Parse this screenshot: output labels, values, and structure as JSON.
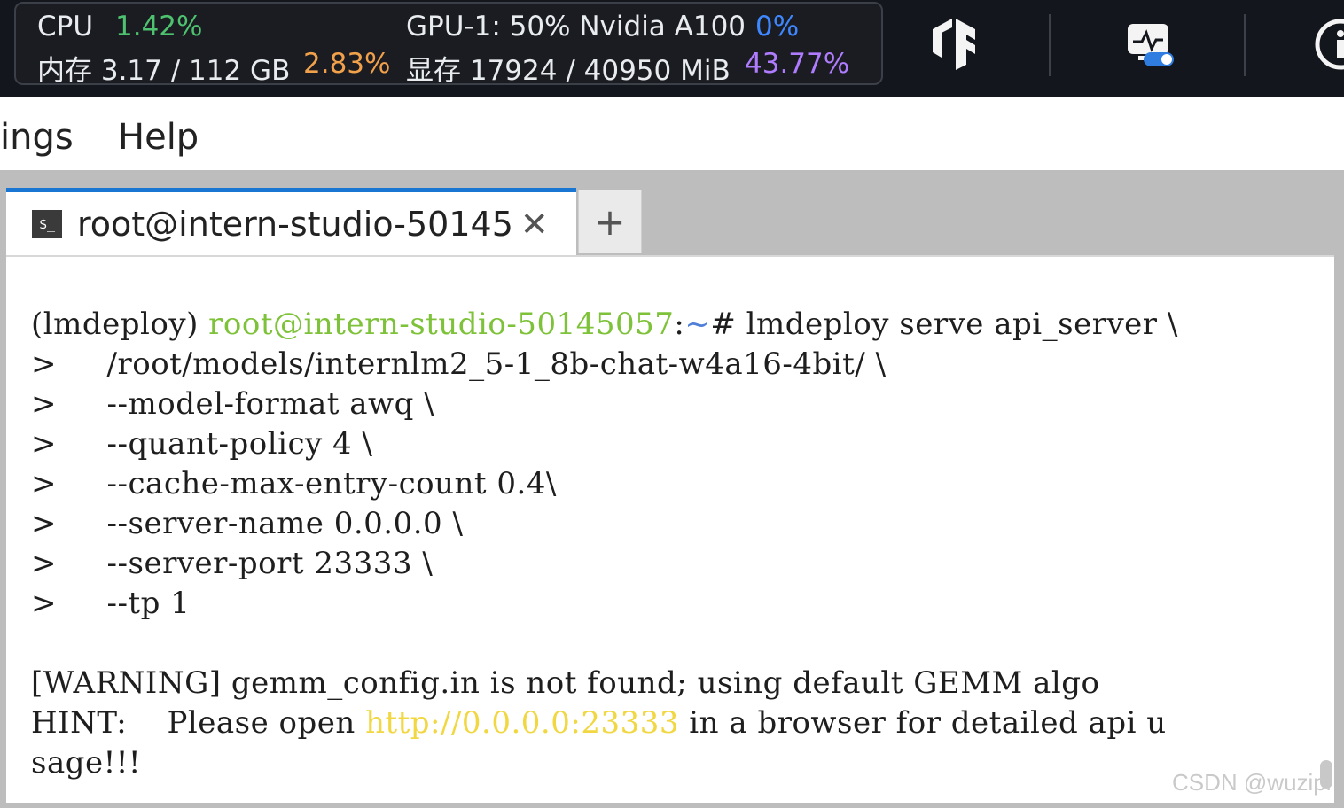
{
  "stats": {
    "cpu_label": "CPU",
    "cpu_value": "1.42%",
    "mem_label": "内存 3.17 / 112 GB",
    "mem_value": "2.83%",
    "gpu_label": "GPU-1: 50% Nvidia A100",
    "gpu_value": "0%",
    "vram_label": "显存 17924 / 40950 MiB",
    "vram_value": "43.77%"
  },
  "toolbar": {
    "tensorflow_icon": "tensorflow-icon",
    "monitor_icon": "monitor-toggle-icon",
    "info_icon": "info-icon"
  },
  "menu": {
    "items": [
      "ings",
      "Help"
    ]
  },
  "tabs": {
    "active_title": "root@intern-studio-50145",
    "close_glyph": "✕",
    "new_tab_glyph": "+",
    "terminal_icon_text": "$_"
  },
  "terminal": {
    "env": "(lmdeploy) ",
    "user_host": "root@intern-studio-50145057",
    "colon": ":",
    "path": "~",
    "command": "# lmdeploy serve api_server \\",
    "continuation_lines": [
      ">     /root/models/internlm2_5-1_8b-chat-w4a16-4bit/ \\",
      ">     --model-format awq \\",
      ">     --quant-policy 4 \\",
      ">     --cache-max-entry-count 0.4\\",
      ">     --server-name 0.0.0.0 \\",
      ">     --server-port 23333 \\",
      ">     --tp 1"
    ],
    "warning": "[WARNING] gemm_config.in is not found; using default GEMM algo",
    "hint_prefix": "HINT:    Please open ",
    "hint_link": "http://0.0.0.0:23333",
    "hint_suffix": " in a browser for detailed api u",
    "hint_wrap": "sage!!!"
  },
  "watermark": "CSDN @wuzipi"
}
